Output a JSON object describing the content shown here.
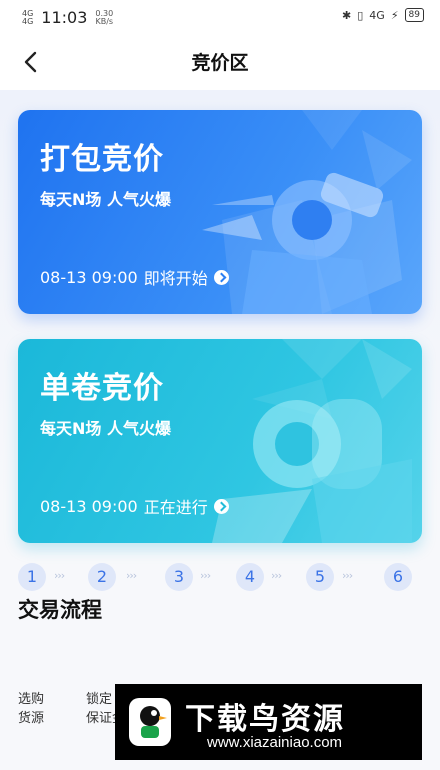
{
  "status_bar": {
    "signal1": "4G",
    "signal2": "4G",
    "time": "11:03",
    "net_speed_value": "0.30",
    "net_speed_unit": "KB/s",
    "net_right": "4G",
    "battery": "89"
  },
  "nav": {
    "title": "竞价区"
  },
  "cards": [
    {
      "title": "打包竞价",
      "subtitle": "每天N场 人气火爆",
      "time": "08-13 09:00",
      "status": "即将开始"
    },
    {
      "title": "单卷竞价",
      "subtitle": "每天N场 人气火爆",
      "time": "08-13 09:00",
      "status": "正在进行"
    }
  ],
  "process": {
    "title": "交易流程",
    "steps": [
      {
        "num": "1",
        "label_line1": "选购",
        "label_line2": "货源"
      },
      {
        "num": "2",
        "label_line1": "锁定",
        "label_line2": "保证金"
      },
      {
        "num": "3"
      },
      {
        "num": "4"
      },
      {
        "num": "5"
      },
      {
        "num": "6"
      }
    ],
    "arrow": "›››"
  },
  "watermark": {
    "title": "下载鸟资源",
    "url": "www.xiazainiao.com"
  },
  "colors": {
    "card1": "#1f73f0",
    "card2": "#1bb8d9",
    "step_bg": "#dfe7f9",
    "step_text": "#3b73e6"
  }
}
